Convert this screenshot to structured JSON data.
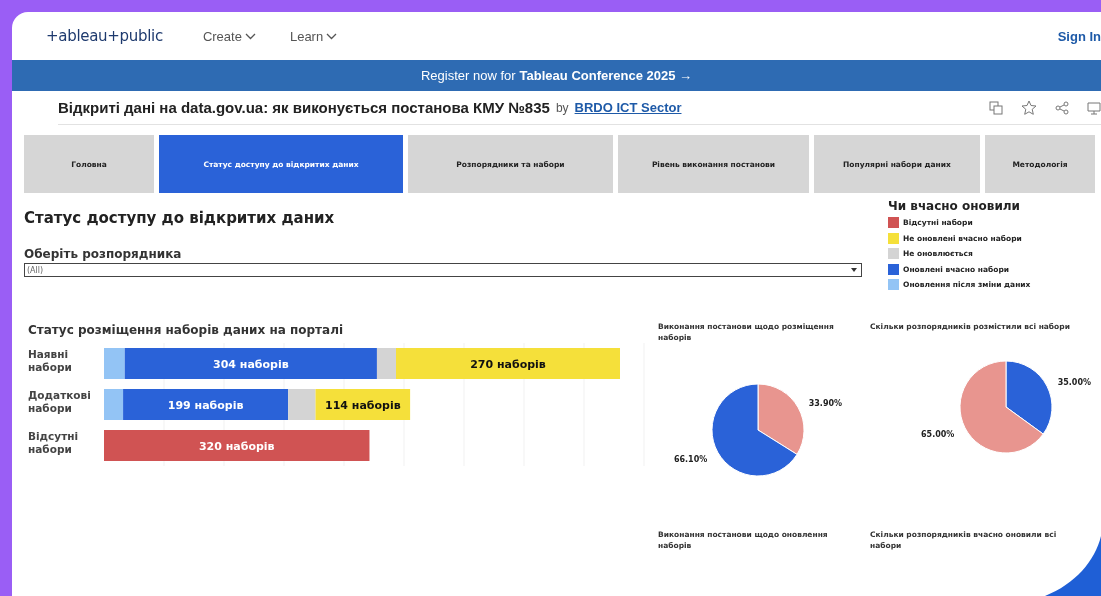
{
  "site_header": {
    "logo": "+ableau+public",
    "nav": [
      {
        "label": "Create"
      },
      {
        "label": "Learn"
      }
    ],
    "sign_in": "Sign In"
  },
  "banner": {
    "text": "Register now for",
    "link": "Tableau Conference 2025 →"
  },
  "viz_title": {
    "title": "Відкриті дані на data.gov.ua: як виконується постанова КМУ №835",
    "by": "by",
    "author": "BRDO ICT Sector"
  },
  "tabs": [
    {
      "label": "Головна",
      "selected": false
    },
    {
      "label": "Статус доступу до відкритих даних",
      "selected": true
    },
    {
      "label": "Розпорядники та набори",
      "selected": false
    },
    {
      "label": "Рівень виконання постанови",
      "selected": false
    },
    {
      "label": "Популярні набори даних",
      "selected": false
    },
    {
      "label": "Методологія",
      "selected": false
    }
  ],
  "page_heading": "Статус доступу до відкритих даних",
  "filter": {
    "label": "Оберіть розпорядника",
    "value": "(All)"
  },
  "legend": {
    "title": "Чи вчасно оновили",
    "items": [
      {
        "label": "Відсутні набори",
        "color": "#d05353"
      },
      {
        "label": "Не оновлені вчасно набори",
        "color": "#f5e03a"
      },
      {
        "label": "Не оновлюється",
        "color": "#d4d4d4"
      },
      {
        "label": "Оновлені вчасно набори",
        "color": "#2a62d8"
      },
      {
        "label": "Оновлення після зміни даних",
        "color": "#93c4f5"
      }
    ]
  },
  "bar_chart": {
    "chart_data": {
      "type": "bar",
      "title": "Статус розміщення наборів даних на порталі",
      "orientation": "horizontal",
      "stacked": true,
      "categories": [
        "Наявні набори",
        "Додаткові набори",
        "Відсутні набори"
      ],
      "series": [
        {
          "color": "#93c4f5",
          "values": [
            25,
            23,
            null
          ],
          "value_labels": [
            null,
            null,
            null
          ]
        },
        {
          "color": "#2a62d8",
          "values": [
            304,
            199,
            null
          ],
          "value_labels": [
            "304 наборів",
            "199 наборів",
            null
          ]
        },
        {
          "color": "#d4d4d4",
          "values": [
            23,
            33,
            null
          ],
          "value_labels": [
            null,
            null,
            null
          ]
        },
        {
          "color": "#f5e03a",
          "values": [
            270,
            114,
            null
          ],
          "value_labels": [
            "270 наборів",
            "114 наборів",
            null
          ]
        },
        {
          "color": "#d05353",
          "values": [
            null,
            null,
            320
          ],
          "value_labels": [
            null,
            null,
            "320 наборів"
          ]
        }
      ]
    }
  },
  "pies": [
    {
      "chart_data": {
        "type": "pie",
        "title": "Виконання постанови щодо розміщення наборів",
        "values": [
          33.9,
          66.1
        ],
        "colors": [
          "#e8958f",
          "#2a62d8"
        ],
        "value_labels": [
          "33.90%",
          "66.10%"
        ]
      }
    },
    {
      "chart_data": {
        "type": "pie",
        "title": "Скільки розпорядників розмістили всі набори",
        "values": [
          35,
          65
        ],
        "colors": [
          "#2a62d8",
          "#e8958f"
        ],
        "value_labels": [
          "35.00%",
          "65.00%"
        ]
      }
    }
  ],
  "lower_titles": [
    "Виконання постанови щодо оновлення наборів",
    "Скільки розпорядників вчасно оновили всі набори"
  ]
}
